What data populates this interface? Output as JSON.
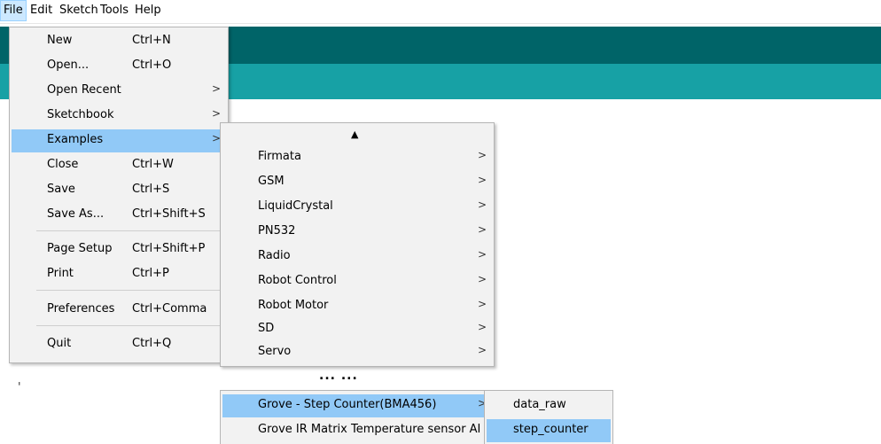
{
  "menubar": {
    "items": [
      "File",
      "Edit",
      "Sketch",
      "Tools",
      "Help"
    ]
  },
  "file_menu": {
    "items": [
      {
        "label": "New",
        "shortcut": "Ctrl+N"
      },
      {
        "label": "Open...",
        "shortcut": "Ctrl+O"
      },
      {
        "label": "Open Recent",
        "shortcut": ">"
      },
      {
        "label": "Sketchbook",
        "shortcut": ">"
      },
      {
        "label": "Examples",
        "shortcut": ">"
      },
      {
        "label": "Close",
        "shortcut": "Ctrl+W"
      },
      {
        "label": "Save",
        "shortcut": "Ctrl+S"
      },
      {
        "label": "Save As...",
        "shortcut": "Ctrl+Shift+S"
      },
      {
        "label": "Page Setup",
        "shortcut": "Ctrl+Shift+P"
      },
      {
        "label": "Print",
        "shortcut": "Ctrl+P"
      },
      {
        "label": "Preferences",
        "shortcut": "Ctrl+Comma"
      },
      {
        "label": "Quit",
        "shortcut": "Ctrl+Q"
      }
    ]
  },
  "examples_menu": {
    "scroll_up": "▲",
    "items": [
      {
        "label": "Firmata",
        "arrow": ">"
      },
      {
        "label": "GSM",
        "arrow": ">"
      },
      {
        "label": "LiquidCrystal",
        "arrow": ">"
      },
      {
        "label": "PN532",
        "arrow": ">"
      },
      {
        "label": "Radio",
        "arrow": ">"
      },
      {
        "label": "Robot Control",
        "arrow": ">"
      },
      {
        "label": "Robot Motor",
        "arrow": ">"
      },
      {
        "label": "SD",
        "arrow": ">"
      },
      {
        "label": "Servo",
        "arrow": ">"
      }
    ],
    "ellipsis": "... ...",
    "lower_items": [
      {
        "label": "Grove - Step Counter(BMA456)",
        "arrow": ">"
      },
      {
        "label": "Grove IR Matrix Temperature sensor AI",
        "arrow": ""
      }
    ]
  },
  "step_counter_menu": {
    "items": [
      {
        "label": "data_raw"
      },
      {
        "label": "step_counter"
      }
    ]
  },
  "editor": {
    "marks": [
      "'",
      "'"
    ]
  }
}
